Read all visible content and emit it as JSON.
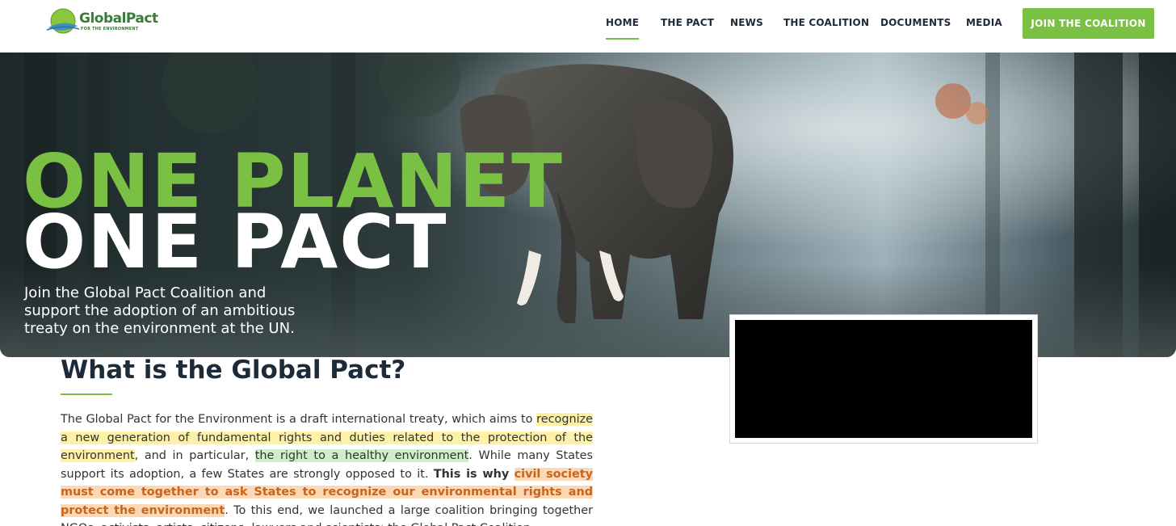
{
  "header": {
    "logo_text": "GlobalPact",
    "logo_sub": "FOR THE ENVIRONMENT",
    "nav": [
      {
        "label": "HOME",
        "active": true
      },
      {
        "label": "THE PACT",
        "active": false
      },
      {
        "label": "NEWS",
        "active": false
      },
      {
        "label": "THE COALITION",
        "active": false
      },
      {
        "label": "DOCUMENTS",
        "active": false
      },
      {
        "label": "MEDIA",
        "active": false
      }
    ],
    "cta_label": "JOIN THE COALITION"
  },
  "hero": {
    "line1": "ONE PLANET",
    "line2": "ONE PACT",
    "subtitle": "Join the Global Pact Coalition and support the adoption of an ambitious treaty on the environment at the UN."
  },
  "main": {
    "title": "What is the Global Pact?",
    "paragraph": {
      "p1": "The Global Pact for the Environment is a draft international treaty, which aims to ",
      "hl1": "recognize a new generation of fundamental rights and duties related to the protection of the environment",
      "p2": ", and in particular, ",
      "hl2": "the right to a healthy environment",
      "p3": ". While many States support its adoption, a few States are strongly opposed to it. ",
      "strong": "This is why",
      "p4": " ",
      "hl3": "civil society must come together to ask States to recognize our environmental rights and protect the environment",
      "p5": ". To this end, we launched a large coalition bringing together NGOs, activists, artists, citizens, lawyers and scientists: the Global Pact Coalition."
    }
  },
  "colors": {
    "brand_green": "#7ac143",
    "nav_text": "#1d2a3a",
    "highlight_yellow": "#fdf1a8",
    "highlight_green": "#cdeec8",
    "highlight_orange": "#fcd9b6"
  }
}
